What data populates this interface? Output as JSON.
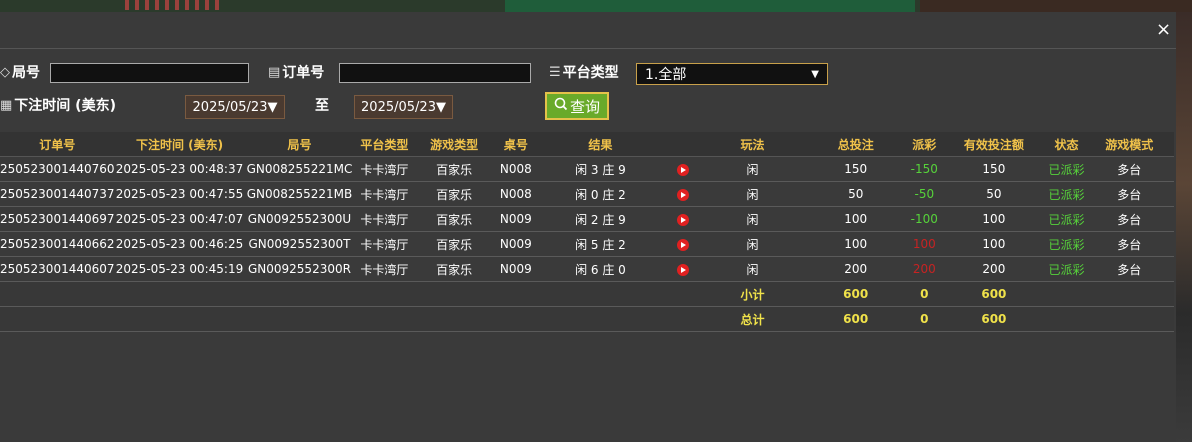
{
  "dialog": {
    "close_label": "×"
  },
  "filters": {
    "round_label": "局号",
    "round_value": "",
    "order_label": "订单号",
    "order_value": "",
    "platform_label": "平台类型",
    "platform_selected": "1.全部",
    "time_label": "下注时间 (美东)",
    "date_from": "2025/05/23▼",
    "to_label": "至",
    "date_to": "2025/05/23▼",
    "query_label": "查询"
  },
  "table": {
    "headers": [
      "订单号",
      "下注时间 (美东)",
      "局号",
      "平台类型",
      "游戏类型",
      "桌号",
      "结果",
      "",
      "玩法",
      "总投注",
      "派彩",
      "有效投注额",
      "状态",
      "游戏模式"
    ],
    "rows": [
      {
        "order": "250523001440760",
        "time": "2025-05-23 00:48:37",
        "round": "GN008255221MC",
        "platform": "卡卡湾厅",
        "game": "百家乐",
        "table": "N008",
        "result": "闲 3 庄 9",
        "play": "闲",
        "bet": "150",
        "payout": "-150",
        "valid": "150",
        "status": "已派彩",
        "mode": "多台",
        "payout_color": "#56d23a"
      },
      {
        "order": "250523001440737",
        "time": "2025-05-23 00:47:55",
        "round": "GN008255221MB",
        "platform": "卡卡湾厅",
        "game": "百家乐",
        "table": "N008",
        "result": "闲 0 庄 2",
        "play": "闲",
        "bet": "50",
        "payout": "-50",
        "valid": "50",
        "status": "已派彩",
        "mode": "多台",
        "payout_color": "#56d23a"
      },
      {
        "order": "250523001440697",
        "time": "2025-05-23 00:47:07",
        "round": "GN0092552300U",
        "platform": "卡卡湾厅",
        "game": "百家乐",
        "table": "N009",
        "result": "闲 2 庄 9",
        "play": "闲",
        "bet": "100",
        "payout": "-100",
        "valid": "100",
        "status": "已派彩",
        "mode": "多台",
        "payout_color": "#56d23a"
      },
      {
        "order": "250523001440662",
        "time": "2025-05-23 00:46:25",
        "round": "GN0092552300T",
        "platform": "卡卡湾厅",
        "game": "百家乐",
        "table": "N009",
        "result": "闲 5 庄 2",
        "play": "闲",
        "bet": "100",
        "payout": "100",
        "valid": "100",
        "status": "已派彩",
        "mode": "多台",
        "payout_color": "#c62323"
      },
      {
        "order": "250523001440607",
        "time": "2025-05-23 00:45:19",
        "round": "GN0092552300R",
        "platform": "卡卡湾厅",
        "game": "百家乐",
        "table": "N009",
        "result": "闲 6 庄 0",
        "play": "闲",
        "bet": "200",
        "payout": "200",
        "valid": "200",
        "status": "已派彩",
        "mode": "多台",
        "payout_color": "#c62323"
      }
    ],
    "subtotal": {
      "label": "小计",
      "bet": "600",
      "payout": "0",
      "valid": "600"
    },
    "total": {
      "label": "总计",
      "bet": "600",
      "payout": "0",
      "valid": "600"
    }
  },
  "colors": {
    "accent": "#f0c24a",
    "negative": "#56d23a",
    "positive": "#c62323",
    "query_button": "#69aa2a"
  },
  "icons": {
    "round": "tag-icon",
    "order": "clipboard-icon",
    "platform": "list-icon",
    "time": "calendar-icon",
    "query": "search-icon",
    "video": "play-icon",
    "select": "chevron-down-icon"
  }
}
